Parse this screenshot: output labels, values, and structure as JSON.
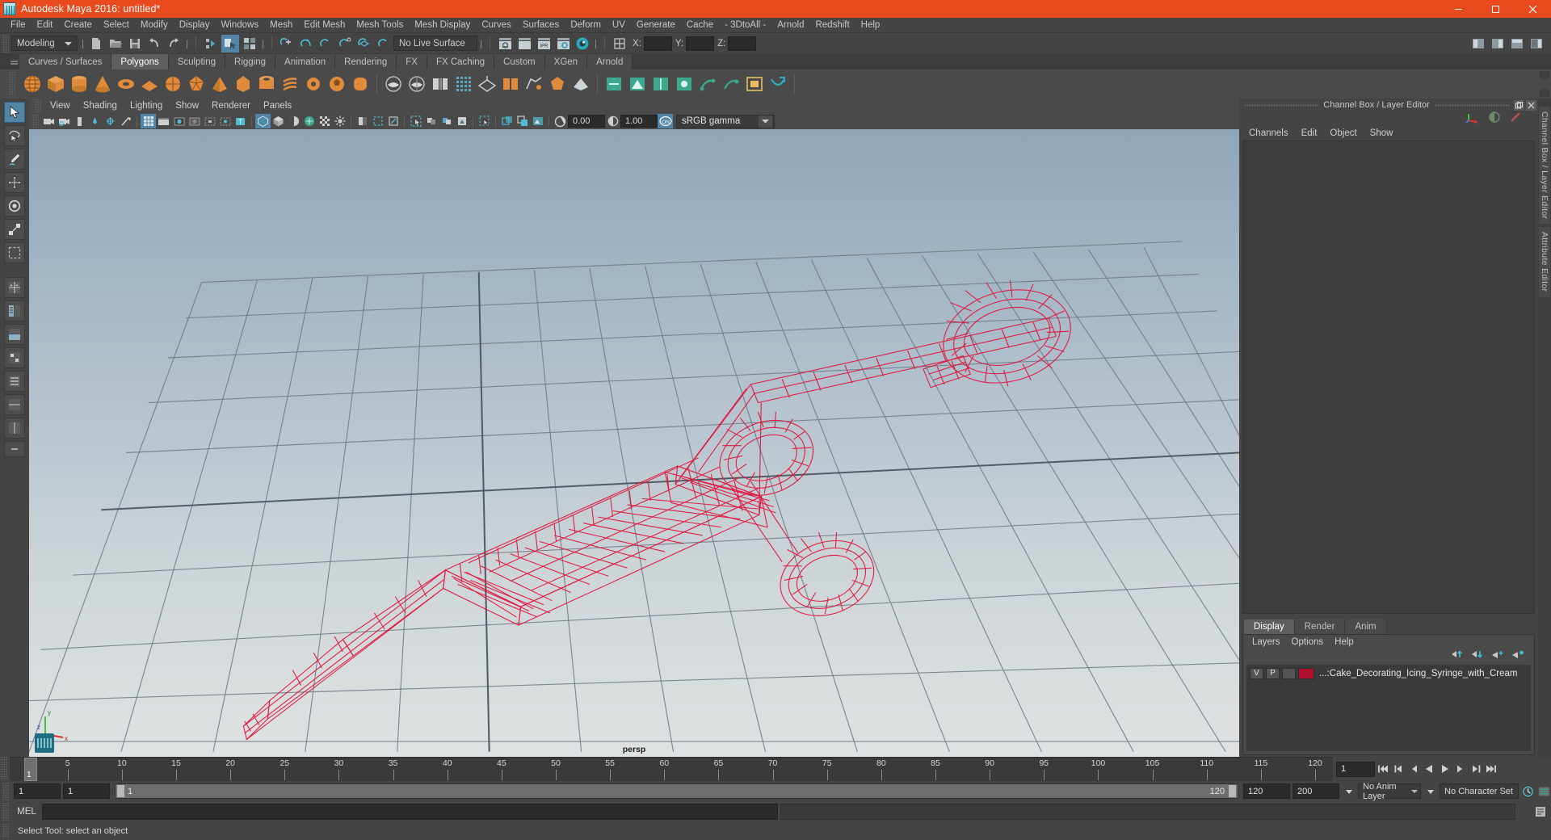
{
  "window": {
    "title": "Autodesk Maya 2016: untitled*",
    "app_icon": "maya-icon",
    "minimize_label": "Minimize",
    "maximize_label": "Restore",
    "close_label": "Close",
    "titlebar_color": "#e8491d"
  },
  "menubar": {
    "items": [
      "File",
      "Edit",
      "Create",
      "Select",
      "Modify",
      "Display",
      "Windows",
      "Mesh",
      "Edit Mesh",
      "Mesh Tools",
      "Mesh Display",
      "Curves",
      "Surfaces",
      "Deform",
      "UV",
      "Generate",
      "Cache",
      "- 3DtoAll -",
      "Arnold",
      "Redshift",
      "Help"
    ]
  },
  "statusline": {
    "mode": "Modeling",
    "live_surface": "No Live Surface",
    "coord_x_label": "X:",
    "coord_y_label": "Y:",
    "coord_z_label": "Z:",
    "coord_x_value": "",
    "coord_y_value": "",
    "coord_z_value": "",
    "icons": [
      "new-scene-icon",
      "open-scene-icon",
      "save-scene-icon",
      "undo-icon",
      "redo-icon",
      "select-by-hierarchy-icon",
      "select-by-object-icon",
      "select-by-component-icon",
      "snap-to-grid-icon",
      "snap-to-curve-icon",
      "snap-to-point-icon",
      "snap-to-projected-center-icon",
      "snap-to-view-plane-icon",
      "make-live-icon",
      "render-view-icon",
      "render-sequence-icon",
      "ipr-render-icon",
      "render-settings-icon",
      "hypershade-icon",
      "input-output-connections-icon"
    ],
    "right_icons": [
      "show-hide-modeling-toolkit-icon",
      "show-hide-attribute-editor-icon",
      "show-hide-tool-settings-icon",
      "show-hide-channel-box-icon"
    ]
  },
  "shelf": {
    "tabs": [
      "Curves / Surfaces",
      "Polygons",
      "Sculpting",
      "Rigging",
      "Animation",
      "Rendering",
      "FX",
      "FX Caching",
      "Custom",
      "XGen",
      "Arnold"
    ],
    "active_tab": "Polygons",
    "icons": [
      "poly-sphere-icon",
      "poly-cube-icon",
      "poly-cylinder-icon",
      "poly-cone-icon",
      "poly-torus-icon",
      "poly-plane-icon",
      "poly-disc-icon",
      "poly-platonic-icon",
      "poly-pyramid-icon",
      "poly-prism-icon",
      "poly-pipe-icon",
      "poly-helix-icon",
      "poly-gear-icon",
      "poly-soccerball-icon",
      "poly-superellipse-icon",
      "combine-icon",
      "separate-icon",
      "booleans-icon",
      "smooth-icon",
      "extrude-icon",
      "bevel-icon",
      "bridge-icon",
      "fill-hole-icon",
      "multi-cut-icon",
      "target-weld-icon",
      "quad-draw-icon",
      "mirror-icon",
      "sculpt-icon",
      "append-icon",
      "wedge-icon",
      "duplicate-face-icon",
      "poke-icon",
      "connect-icon",
      "detach-icon",
      "merge-icon"
    ]
  },
  "toolbox": {
    "tools": [
      "select-tool",
      "lasso-select-tool",
      "paint-select-tool",
      "move-tool",
      "rotate-tool",
      "scale-tool",
      "last-tool-used",
      "four-view-layout",
      "persp-outliner-layout",
      "persp-graph-layout",
      "persp-hypershade-layout",
      "persp-relationship-layout",
      "single-perspective-layout",
      "two-pane-layout",
      "more-layouts"
    ],
    "selected": "select-tool"
  },
  "viewport": {
    "menus": [
      "View",
      "Shading",
      "Lighting",
      "Show",
      "Renderer",
      "Panels"
    ],
    "toolbar_icons": [
      "select-camera-icon",
      "lock-camera-icon",
      "camera-attributes-icon",
      "bookmark-icon",
      "image-plane-icon",
      "two-d-pan-zoom-icon",
      "grid-icon",
      "film-gate-icon",
      "resolution-gate-icon",
      "gate-mask-icon",
      "film-origin-icon",
      "safe-action-icon",
      "title-safe-icon",
      "xray-icon",
      "shaded-icon",
      "wireframe-on-shaded-icon",
      "textured-icon",
      "use-all-lights-icon",
      "shadows-icon",
      "screen-space-ao-icon",
      "motion-blur-icon",
      "multisample-icon",
      "depth-of-field-icon",
      "isolate-select-icon",
      "toggle-frame-icon",
      "snapshot-icon"
    ],
    "exposure_value": "0.00",
    "gamma_value": "1.00",
    "color_management_enabled": "ON",
    "view_transform": "sRGB gamma",
    "camera_label": "persp",
    "model_name": "Cake Decorating Icing Syringe with Cream",
    "wireframe_color": "#e0143c",
    "axis_labels": {
      "x": "x",
      "y": "y",
      "z": "z"
    }
  },
  "right_dock": {
    "panel_title": "Channel Box / Layer Editor",
    "channel_menus": [
      "Channels",
      "Edit",
      "Object",
      "Show"
    ],
    "top_tool_icons": [
      "channel-box-toggle-icon",
      "attribute-editor-toggle-icon",
      "layer-editor-toggle-icon"
    ],
    "layer_editor": {
      "tabs": [
        "Display",
        "Render",
        "Anim"
      ],
      "active_tab": "Display",
      "menus": [
        "Layers",
        "Options",
        "Help"
      ],
      "buttons": [
        "move-layer-up-icon",
        "move-layer-down-icon",
        "new-layer-icon",
        "new-layer-from-selected-icon"
      ],
      "layers": [
        {
          "visibility": "V",
          "playback": "P",
          "shading": "",
          "color": "#b01030",
          "name": "...:Cake_Decorating_Icing_Syringe_with_Cream"
        }
      ]
    },
    "vertical_tabs": [
      "Channel Box / Layer Editor",
      "Attribute Editor"
    ]
  },
  "timeline": {
    "start_frame": "1",
    "end_frame": "120",
    "current_frame": "1",
    "ticks": [
      5,
      10,
      15,
      20,
      25,
      30,
      35,
      40,
      45,
      50,
      55,
      60,
      65,
      70,
      75,
      80,
      85,
      90,
      95,
      100,
      105,
      110,
      115,
      120
    ],
    "playback_buttons": [
      "go-to-start-icon",
      "step-back-frame-icon",
      "step-back-key-icon",
      "play-backwards-icon",
      "play-forwards-icon",
      "step-forward-key-icon",
      "step-forward-frame-icon",
      "go-to-end-icon"
    ],
    "frame_field": "1"
  },
  "range_slider": {
    "anim_start": "1",
    "range_start": "1",
    "slider_start_label": "1",
    "slider_end_label": "120",
    "range_end": "120",
    "anim_end": "200",
    "anim_layer": "No Anim Layer",
    "character_set": "No Character Set",
    "auto_key_icon": "auto-keyframe-icon",
    "prefs_icon": "animation-preferences-icon"
  },
  "command_line": {
    "label": "MEL",
    "input_value": "",
    "output_value": "",
    "script_editor_icon": "script-editor-icon"
  },
  "statusbar": {
    "message": "Select Tool: select an object"
  }
}
